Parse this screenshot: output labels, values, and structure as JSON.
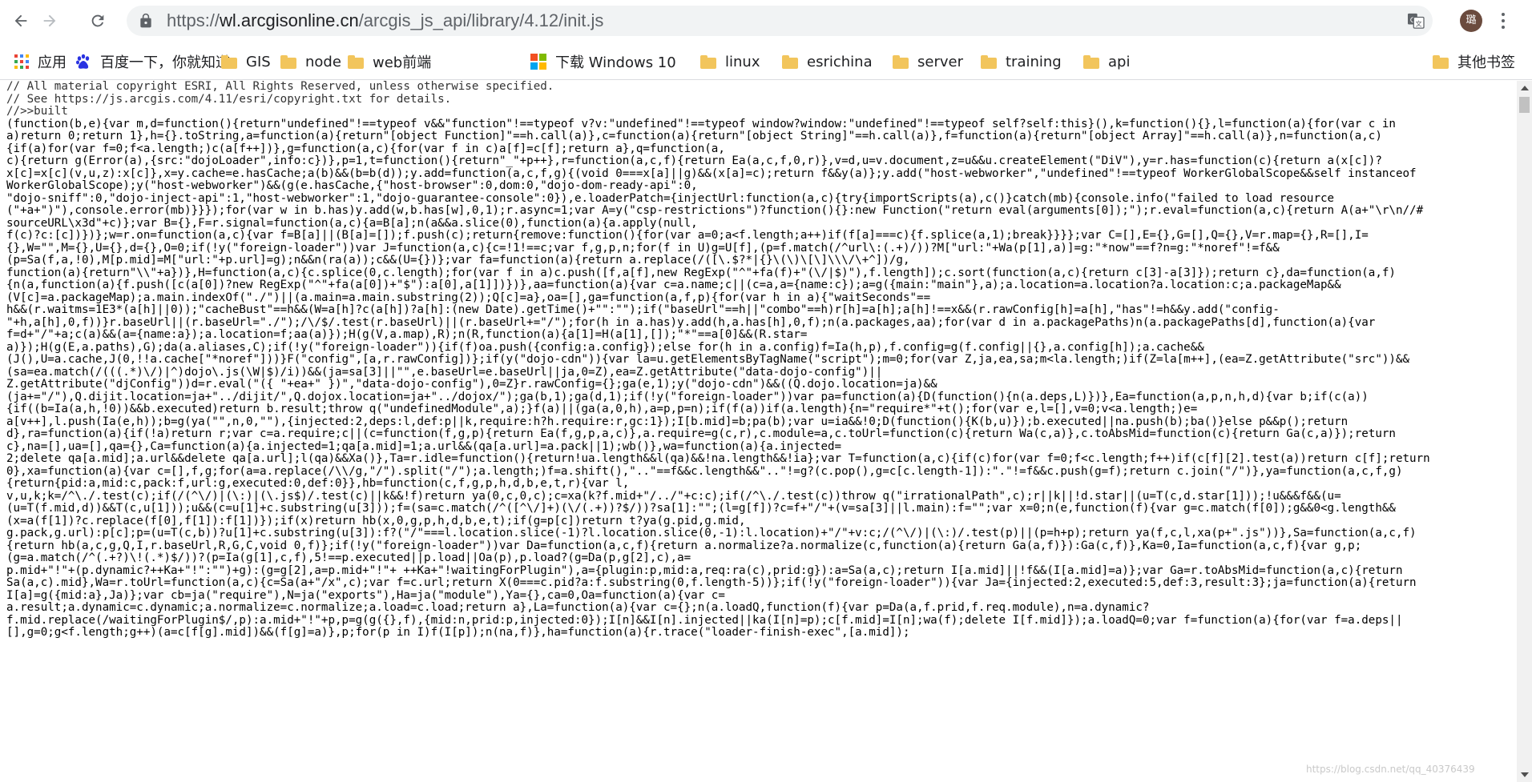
{
  "browser": {
    "url": {
      "protocol": "https://",
      "host": "wl.arcgisonline.cn",
      "path": "/arcgis_js_api/library/4.12/init.js"
    },
    "avatar_initial": "璐",
    "icons": {
      "back": "back-arrow-icon",
      "forward": "forward-arrow-icon",
      "reload": "reload-icon",
      "lock": "lock-icon",
      "translate": "translate-icon",
      "menu": "more-vert-icon"
    },
    "colors": {
      "toolbar_bg": "#ffffff",
      "omnibox_bg": "#f1f3f4",
      "folder": "#f2c55c"
    }
  },
  "bookmarks": {
    "items": [
      {
        "label": "应用",
        "icon": "apps-grid-icon"
      },
      {
        "label": "百度一下，你就知道",
        "icon": "baidu-paw-icon"
      },
      {
        "label": "GIS",
        "icon": "folder-icon"
      },
      {
        "label": "node",
        "icon": "folder-icon"
      },
      {
        "label": "web前端",
        "icon": "folder-icon"
      },
      {
        "label": "下载 Windows 10",
        "icon": "windows-logo-icon"
      },
      {
        "label": "linux",
        "icon": "folder-icon"
      },
      {
        "label": "esrichina",
        "icon": "folder-icon"
      },
      {
        "label": "server",
        "icon": "folder-icon"
      },
      {
        "label": "training",
        "icon": "folder-icon"
      },
      {
        "label": "api",
        "icon": "folder-icon"
      }
    ],
    "other": {
      "label": "其他书签",
      "icon": "folder-icon"
    }
  },
  "source": {
    "lines": [
      "// All material copyright ESRI, All Rights Reserved, unless otherwise specified.",
      "// See https://js.arcgis.com/4.11/esri/copyright.txt for details.",
      "//>>built",
      "(function(b,e){var m,d=function(){return\"undefined\"!==typeof v&&\"function\"!==typeof v?v:\"undefined\"!==typeof window?window:\"undefined\"!==typeof self?self:this}(),k=function(){},l=function(a){for(var c in",
      "a)return 0;return 1},h={}.toString,a=function(a){return\"[object Function]\"==h.call(a)},c=function(a){return\"[object String]\"==h.call(a)},f=function(a){return\"[object Array]\"==h.call(a)},n=function(a,c)",
      "{if(a)for(var f=0;f<a.length;)c(a[f++])},g=function(a,c){for(var f in c)a[f]=c[f];return a},q=function(a,",
      "c){return g(Error(a),{src:\"dojoLoader\",info:c})},p=1,t=function(){return\"_\"+p++},r=function(a,c,f){return Ea(a,c,f,0,r)},v=d,u=v.document,z=u&&u.createElement(\"DiV\"),y=r.has=function(c){return a(x[c])?",
      "x[c]=x[c](v,u,z):x[c]},x=y.cache=e.hasCache;a(b)&&(b=b(d));y.add=function(a,c,f,g){(void 0===x[a]||g)&&(x[a]=c);return f&&y(a)};y.add(\"host-webworker\",\"undefined\"!==typeof WorkerGlobalScope&&self instanceof",
      "WorkerGlobalScope);y(\"host-webworker\")&&(g(e.hasCache,{\"host-browser\":0,dom:0,\"dojo-dom-ready-api\":0,",
      "\"dojo-sniff\":0,\"dojo-inject-api\":1,\"host-webworker\":1,\"dojo-guarantee-console\":0}),e.loaderPatch={injectUrl:function(a,c){try{importScripts(a),c()}catch(mb){console.info(\"failed to load resource",
      "(\"+a+\")\"),console.error(mb)}}});for(var w in b.has)y.add(w,b.has[w],0,1);r.async=1;var A=y(\"csp-restrictions\")?function(){}:new Function(\"return eval(arguments[0]);\");r.eval=function(a,c){return A(a+\"\\r\\n//#",
      "sourceURL\\x3d\"+c)};var B={},F=r.signal=function(a,c){a=B[a];n(a&&a.slice(0),function(a){a.apply(null,",
      "f(c)?c:[c])})};w=r.on=function(a,c){var f=B[a]||(B[a]=[]);f.push(c);return{remove:function(){for(var a=0;a<f.length;a++)if(f[a]===c){f.splice(a,1);break}}}};var C=[],E={},G=[],Q={},V=r.map={},R=[],I=",
      "{},W=\"\",M={},U={},d={},O=0;if(!y(\"foreign-loader\"))var J=function(a,c){c=!1!==c;var f,g,p,n;for(f in U)g=U[f],(p=f.match(/^url\\:(.+)/))?M[\"url:\"+Wa(p[1],a)]=g:\"*now\"==f?n=g:\"*noref\"!=f&&",
      "(p=Sa(f,a,!0),M[p.mid]=M[\"url:\"+p.url]=g);n&&n(ra(a));c&&(U={})};var fa=function(a){return a.replace(/([\\.$?*|{}\\(\\)\\[\\]\\\\\\/\\+^])/g,",
      "function(a){return\"\\\\\"+a})},H=function(a,c){c.splice(0,c.length);for(var f in a)c.push([f,a[f],new RegExp(\"^\"+fa(f)+\"(\\/|$)\"),f.length]);c.sort(function(a,c){return c[3]-a[3]});return c},da=function(a,f)",
      "{n(a,function(a){f.push([c(a[0])?new RegExp(\"^\"+fa(a[0])+\"$\"):a[0],a[1]])})},aa=function(a){var c=a.name;c||(c=a,a={name:c});a=g({main:\"main\"},a);a.location=a.location?a.location:c;a.packageMap&&",
      "(V[c]=a.packageMap);a.main.indexOf(\"./\")||(a.main=a.main.substring(2));Q[c]=a},oa=[],ga=function(a,f,p){for(var h in a){\"waitSeconds\"==",
      "h&&(r.waitms=1E3*(a[h]||0));\"cacheBust\"==h&&(W=a[h]?c(a[h])?a[h]:(new Date).getTime()+\"\":\"\");if(\"baseUrl\"==h||\"combo\"==h)r[h]=a[h];a[h]!==x&&(r.rawConfig[h]=a[h],\"has\"!=h&&y.add(\"config-",
      "\"+h,a[h],0,f))}r.baseUrl||(r.baseUrl=\"./\");/\\/$/.test(r.baseUrl)||(r.baseUrl+=\"/\");for(h in a.has)y.add(h,a.has[h],0,f);n(a.packages,aa);for(var d in a.packagePaths)n(a.packagePaths[d],function(a){var",
      "f=d+\"/\"+a;c(a)&&(a={name:a});a.location=f;aa(a)});H(g(V,a.map),R);n(R,function(a){a[1]=H(a[1],[]);\"*\"==a[0]&&(R.star=",
      "a)});H(g(E,a.paths),G);da(a.aliases,C);if(!y(\"foreign-loader\")){if(f)oa.push({config:a.config});else for(h in a.config)f=Ia(h,p),f.config=g(f.config||{},a.config[h]);a.cache&&",
      "(J(),U=a.cache,J(0,!!a.cache[\"*noref\"]))}F(\"config\",[a,r.rawConfig])};if(y(\"dojo-cdn\")){var la=u.getElementsByTagName(\"script\");m=0;for(var Z,ja,ea,sa;m<la.length;)if(Z=la[m++],(ea=Z.getAttribute(\"src\"))&&",
      "(sa=ea.match(/(((.*)\\/)|^)dojo\\.js(\\W|$)/i))&&(ja=sa[3]||\"\",e.baseUrl=e.baseUrl||ja,0=Z),ea=Z.getAttribute(\"data-dojo-config\")||",
      "Z.getAttribute(\"djConfig\"))d=r.eval(\"({ \"+ea+\" })\",\"data-dojo-config\"),0=Z}r.rawConfig={};ga(e,1);y(\"dojo-cdn\")&&((Q.dojo.location=ja)&&",
      "(ja+=\"/\"),Q.dijit.location=ja+\"../dijit/\",Q.dojox.location=ja+\"../dojox/\");ga(b,1);ga(d,1);if(!y(\"foreign-loader\"))var pa=function(a){D(function(){n(a.deps,L)})},Ea=function(a,p,n,h,d){var b;if(c(a))",
      "{if((b=Ia(a,h,!0))&&b.executed)return b.result;throw q(\"undefinedModule\",a);}f(a)||(ga(a,0,h),a=p,p=n);if(f(a))if(a.length){n=\"require*\"+t();for(var e,l=[],v=0;v<a.length;)e=",
      "a[v++],l.push(Ia(e,h));b=g(ya(\"\",n,0,\"\"),{injected:2,deps:l,def:p||k,require:h?h.require:r,gc:1});I[b.mid]=b;pa(b);var u=ia&&!0;D(function(){K(b,u)});b.executed||na.push(b);ba()}else p&&p();return",
      "d},ra=function(a){if(!a)return r;var c=a.require;c||(c=function(f,g,p){return Ea(f,g,p,a,c)},a.require=g(c,r),c.module=a,c.toUrl=function(c){return Wa(c,a)},c.toAbsMid=function(c){return Ga(c,a)});return",
      "c},na=[],ua=[],qa={},Ca=function(a){a.injected=1;qa[a.mid]=1;a.url&&(qa[a.url]=a.pack||1);wb()},wa=function(a){a.injected=",
      "2;delete qa[a.mid];a.url&&delete qa[a.url];l(qa)&&Xa()},Ta=r.idle=function(){return!ua.length&&l(qa)&&!na.length&&!ia};var T=function(a,c){if(c)for(var f=0;f<c.length;f++)if(c[f][2].test(a))return c[f];return",
      "0},xa=function(a){var c=[],f,g;for(a=a.replace(/\\\\/g,\"/\").split(\"/\");a.length;)f=a.shift(),\"..\"==f&&c.length&&\"..\"!=g?(c.pop(),g=c[c.length-1]):\".\"!=f&&c.push(g=f);return c.join(\"/\")},ya=function(a,c,f,g)",
      "{return{pid:a,mid:c,pack:f,url:g,executed:0,def:0}},hb=function(c,f,g,p,h,d,b,e,t,r){var l,",
      "v,u,k;k=/^\\./.test(c);if(/(^\\/)|(\\:)|(\\.js$)/.test(c)||k&&!f)return ya(0,c,0,c);c=xa(k?f.mid+\"/../\"+c:c);if(/^\\./.test(c))throw q(\"irrationalPath\",c);r||k||!d.star||(u=T(c,d.star[1]));!u&&&f&&(u=",
      "(u=T(f.mid,d))&&T(c,u[1]));u&&(c=u[1]+c.substring(u[3]));f=(sa=c.match(/^([^\\/]+)(\\/(.+))?$/))?sa[1]:\"\";(l=g[f])?c=f+\"/\"+(v=sa[3]||l.main):f=\"\";var x=0;n(e,function(f){var g=c.match(f[0]);g&&0<g.length&&",
      "(x=a(f[1])?c.replace(f[0],f[1]):f[1])});if(x)return hb(x,0,g,p,h,d,b,e,t);if(g=p[c])return t?ya(g.pid,g.mid,",
      "g.pack,g.url):p[c];p=(u=T(c,b))?u[1]+c.substring(u[3]):f?(\"/\"===l.location.slice(-1)?l.location.slice(0,-1):l.location)+\"/\"+v:c;/(^\\/)|(\\:)/.test(p)||(p=h+p);return ya(f,c,l,xa(p+\".js\"))},Sa=function(a,c,f)",
      "{return hb(a,c,g,Q,I,r.baseUrl,R,G,C,void 0,f)};if(!y(\"foreign-loader\"))var Da=function(a,c,f){return a.normalize?a.normalize(c,function(a){return Ga(a,f)}):Ga(c,f)},Ka=0,Ia=function(a,c,f){var g,p;",
      "(g=a.match(/^(.+?)\\!(.*)$/))?(p=Ia(g[1],c,f),5!==p.executed||p.load||Oa(p),p.load?(g=Da(p,g[2],c),a=",
      "p.mid+\"!\"+(p.dynamic?++Ka+\"!\":\"\")+g):(g=g[2],a=p.mid+\"!\"+ ++Ka+\"!waitingForPlugin\"),a={plugin:p,mid:a,req:ra(c),prid:g}):a=Sa(a,c);return I[a.mid]||!f&&(I[a.mid]=a)};var Ga=r.toAbsMid=function(a,c){return",
      "Sa(a,c).mid},Wa=r.toUrl=function(a,c){c=Sa(a+\"/x\",c);var f=c.url;return X(0===c.pid?a:f.substring(0,f.length-5))};if(!y(\"foreign-loader\")){var Ja={injected:2,executed:5,def:3,result:3};ja=function(a){return",
      "I[a]=g({mid:a},Ja)};var cb=ja(\"require\"),N=ja(\"exports\"),Ha=ja(\"module\"),Ya={},ca=0,Oa=function(a){var c=",
      "a.result;a.dynamic=c.dynamic;a.normalize=c.normalize;a.load=c.load;return a},La=function(a){var c={};n(a.loadQ,function(f){var p=Da(a,f.prid,f.req.module),n=a.dynamic?",
      "f.mid.replace(/waitingForPlugin$/,p):a.mid+\"!\"+p,p=g(g({},f),{mid:n,prid:p,injected:0});I[n]&&I[n].injected||ka(I[n]=p);c[f.mid]=I[n];wa(f);delete I[f.mid]});a.loadQ=0;var f=function(a){for(var f=a.deps||",
      "[],g=0;g<f.length;g++)(a=c[f[g].mid])&&(f[g]=a)},p;for(p in I)f(I[p]);n(na,f)},ha=function(a){r.trace(\"loader-finish-exec\",[a.mid]);"
    ]
  },
  "watermark": "https://blog.csdn.net/qq_40376439"
}
